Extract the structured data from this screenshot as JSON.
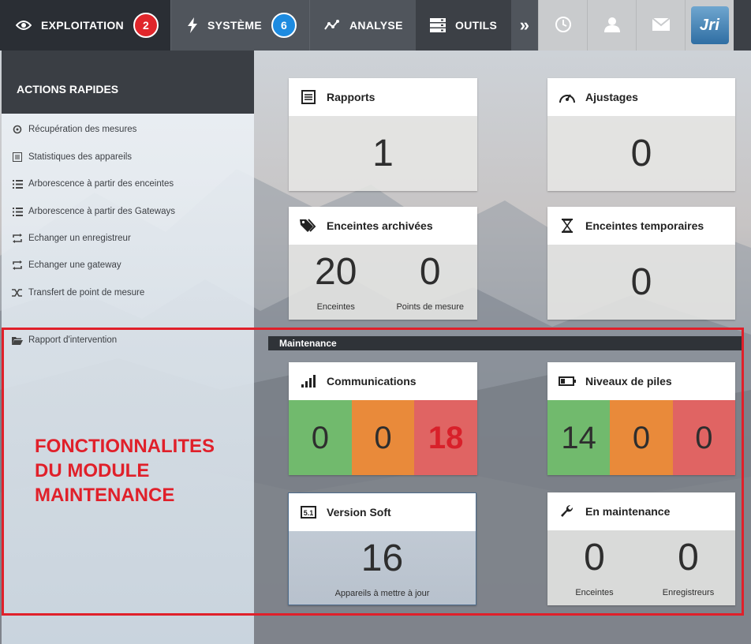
{
  "nav": {
    "exploitation": {
      "label": "EXPLOITATION",
      "badge": "2"
    },
    "systeme": {
      "label": "SYSTÈME",
      "badge": "6"
    },
    "analyse": {
      "label": "ANALYSE"
    },
    "outils": {
      "label": "OUTILS"
    },
    "more": "»",
    "logo_text": "Jri"
  },
  "sidebar": {
    "title": "ACTIONS RAPIDES",
    "items": [
      {
        "label": "Récupération des mesures",
        "icon": "refresh-icon"
      },
      {
        "label": "Statistiques des appareils",
        "icon": "list-icon"
      },
      {
        "label": "Arborescence à partir des enceintes",
        "icon": "tree-list-icon"
      },
      {
        "label": "Arborescence à partir des Gateways",
        "icon": "tree-list-icon"
      },
      {
        "label": "Echanger un enregistreur",
        "icon": "swap-icon"
      },
      {
        "label": "Echanger une gateway",
        "icon": "swap-icon"
      },
      {
        "label": "Transfert de point de mesure",
        "icon": "shuffle-icon"
      },
      {
        "label": "Rapport d'intervention",
        "icon": "folder-open-icon"
      }
    ]
  },
  "panels": {
    "rapports": {
      "title": "Rapports",
      "value": "1"
    },
    "ajustages": {
      "title": "Ajustages",
      "value": "0"
    },
    "archived": {
      "title": "Enceintes archivées",
      "v1": "20",
      "l1": "Enceintes",
      "v2": "0",
      "l2": "Points de mesure"
    },
    "temporaires": {
      "title": "Enceintes temporaires",
      "value": "0"
    },
    "communications": {
      "title": "Communications",
      "green": "0",
      "orange": "0",
      "red": "18"
    },
    "piles": {
      "title": "Niveaux de piles",
      "green": "14",
      "orange": "0",
      "red": "0"
    },
    "version": {
      "title": "Version Soft",
      "value": "16",
      "label": "Appareils à mettre à jour"
    },
    "en_maintenance": {
      "title": "En maintenance",
      "v1": "0",
      "l1": "Enceintes",
      "v2": "0",
      "l2": "Enregistreurs"
    }
  },
  "maintenance_header": "Maintenance",
  "annotation": [
    "FONCTIONNALITES",
    "DU MODULE",
    "MAINTENANCE"
  ],
  "colors": {
    "green": "#71ba6d",
    "orange": "#e98a3a",
    "red": "#e06463",
    "highlight": "#e0202a"
  }
}
